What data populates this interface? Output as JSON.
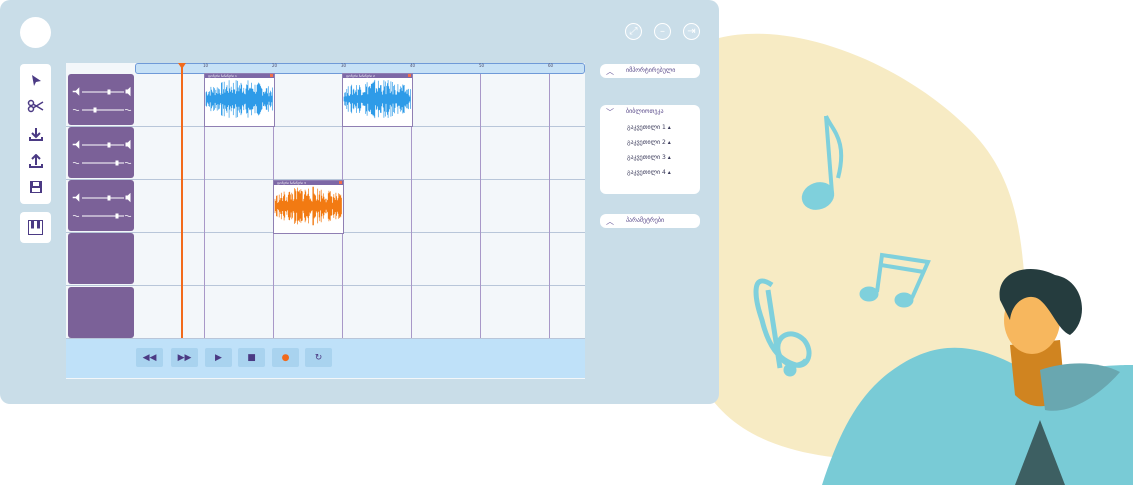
{
  "window": {
    "controls": [
      "expand-icon",
      "minimize-icon",
      "exit-icon"
    ]
  },
  "toolbar": {
    "tools": [
      "cursor-icon",
      "scissors-icon",
      "download-icon",
      "upload-icon",
      "save-icon"
    ],
    "extra": "piano-icon"
  },
  "ruler": {
    "ticks": [
      "10",
      "20",
      "30",
      "40",
      "50",
      "60"
    ]
  },
  "tracks": [
    {
      "has_controls": true
    },
    {
      "has_controls": true
    },
    {
      "has_controls": true
    },
    {
      "has_controls": false
    },
    {
      "has_controls": false
    }
  ],
  "clips": [
    {
      "name": "ფონური ჩანაწერი 1",
      "track": 1,
      "color": "#2e9be8"
    },
    {
      "name": "ფონური ჩანაწერი 2",
      "track": 1,
      "color": "#2e9be8"
    },
    {
      "name": "ფონური ჩანაწერი 3",
      "track": 3,
      "color": "#f27a12"
    }
  ],
  "transport": {
    "buttons": [
      "rewind-icon",
      "fast-forward-icon",
      "play-icon",
      "stop-icon",
      "record-icon",
      "loop-icon"
    ],
    "record_color": "#f26a1b"
  },
  "panels": {
    "import": {
      "title": "იმპორტირებული"
    },
    "library": {
      "title": "ბიბლიოთეკა",
      "items": [
        "გაკვეთილი 1",
        "გაკვეთილი 2",
        "გაკვეთილი 3",
        "გაკვეთილი 4"
      ]
    },
    "settings": {
      "title": "პარამეტრები"
    }
  },
  "colors": {
    "window_bg": "#c9dde8",
    "track_header": "#7b6198",
    "accent_orange": "#f26a1b",
    "accent_blue": "#2e9be8",
    "illustration_bg": "#f7ebc4",
    "person_shirt": "#79cbd6"
  }
}
